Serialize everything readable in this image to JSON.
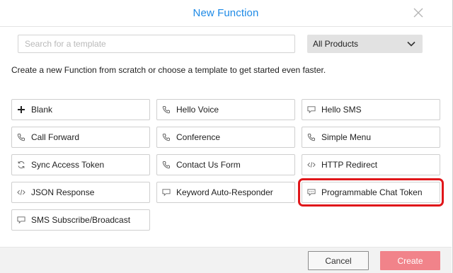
{
  "dialog": {
    "title": "New Function",
    "close_icon": "close-icon"
  },
  "search": {
    "placeholder": "Search for a template",
    "value": ""
  },
  "product_filter": {
    "selected": "All Products",
    "icon": "chevron-down-icon"
  },
  "intro_text": "Create a new Function from scratch or choose a template to get started even faster.",
  "templates": [
    {
      "label": "Blank",
      "icon": "plus-icon"
    },
    {
      "label": "Hello Voice",
      "icon": "phone-icon"
    },
    {
      "label": "Hello SMS",
      "icon": "chat-bubble-icon"
    },
    {
      "label": "Call Forward",
      "icon": "phone-icon"
    },
    {
      "label": "Conference",
      "icon": "phone-icon"
    },
    {
      "label": "Simple Menu",
      "icon": "phone-icon"
    },
    {
      "label": "Sync Access Token",
      "icon": "sync-icon"
    },
    {
      "label": "Contact Us Form",
      "icon": "phone-icon"
    },
    {
      "label": "HTTP Redirect",
      "icon": "code-icon"
    },
    {
      "label": "JSON Response",
      "icon": "code-icon"
    },
    {
      "label": "Keyword Auto-Responder",
      "icon": "chat-bubble-icon"
    },
    {
      "label": "Programmable Chat Token",
      "icon": "chat-dots-icon"
    },
    {
      "label": "SMS Subscribe/Broadcast",
      "icon": "chat-bubble-icon"
    }
  ],
  "selected_template": "Programmable Chat Token",
  "footer": {
    "cancel_label": "Cancel",
    "create_label": "Create"
  },
  "colors": {
    "title": "#1e8ae6",
    "highlight": "#e0161a",
    "create_button": "#f1838a",
    "icon": "#666666"
  }
}
